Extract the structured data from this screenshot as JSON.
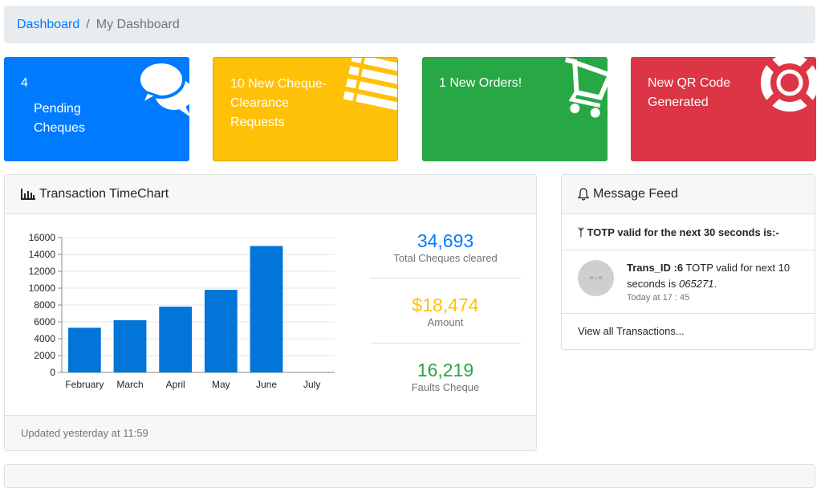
{
  "breadcrumb": {
    "home": "Dashboard",
    "separator": "/",
    "current": "My Dashboard"
  },
  "cards": [
    {
      "line1": "4",
      "line2": "Pending",
      "line3": "Cheques",
      "color": "#007bff",
      "icon": "comments-icon"
    },
    {
      "line1": "10 New Cheque-",
      "line2": "Clearance",
      "line3": "Requests",
      "color": "#ffc107",
      "icon": "list-icon"
    },
    {
      "line1": "1 New Orders!",
      "color": "#28a745",
      "icon": "shopping-cart-icon"
    },
    {
      "line1": "New QR Code",
      "line2": "Generated",
      "color": "#dc3545",
      "icon": "life-ring-icon"
    }
  ],
  "chart_panel": {
    "title": "Transaction TimeChart",
    "footer": "Updated yesterday at 11:59",
    "stats": [
      {
        "value": "34,693",
        "label": "Total Cheques cleared",
        "color": "#007bff"
      },
      {
        "value": "$18,474",
        "label": "Amount",
        "color": "#ffc107"
      },
      {
        "value": "16,219",
        "label": "Faults Cheque",
        "color": "#28a745"
      }
    ]
  },
  "chart_data": {
    "type": "bar",
    "categories": [
      "February",
      "March",
      "April",
      "May",
      "June",
      "July"
    ],
    "values": [
      5300,
      6200,
      7800,
      9800,
      15000,
      null
    ],
    "yticks": [
      0,
      2000,
      4000,
      6000,
      8000,
      10000,
      12000,
      14000,
      16000
    ],
    "ylim": [
      0,
      16000
    ],
    "bar_color": "#0275d8",
    "grid": true
  },
  "feed": {
    "title": "Message Feed",
    "subheader": "TOTP valid for the next 30 seconds is:-",
    "item": {
      "avatar_text": "45 x 45",
      "sender": "Trans_ID :6",
      "text": " TOTP valid for next 10 seconds is ",
      "code": "065271",
      "end": ".",
      "time": "Today at 17 : 45"
    },
    "view_all": "View all Transactions..."
  }
}
